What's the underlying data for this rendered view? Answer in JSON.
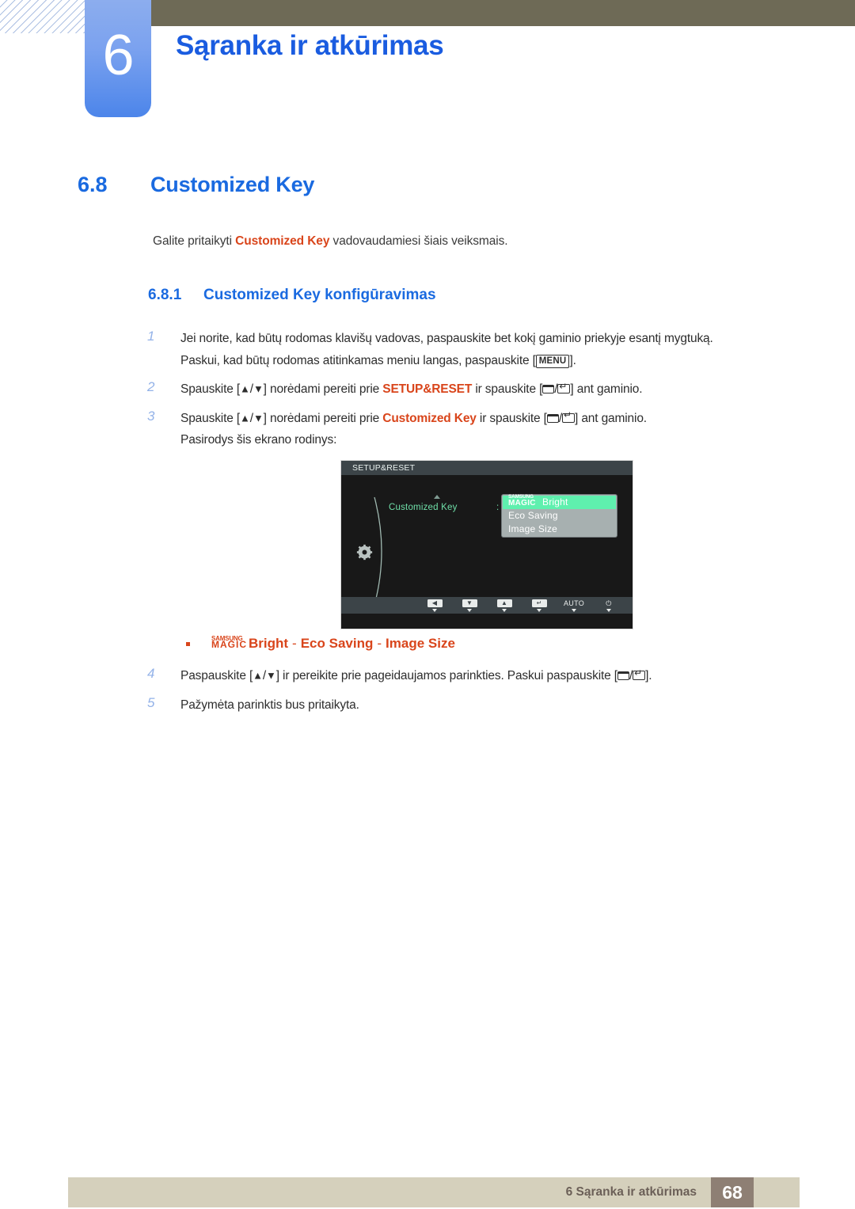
{
  "header": {
    "chapter_number": "6",
    "chapter_title": "Sąranka ir atkūrimas",
    "accent_blue": "#1a5ce0",
    "olive_bar_color": "#6e6a56"
  },
  "section": {
    "number": "6.8",
    "title": "Customized Key",
    "intro_before": "Galite pritaikyti ",
    "intro_keyword": "Customized Key",
    "intro_after": " vadovaudamiesi šiais veiksmais."
  },
  "subsection": {
    "number": "6.8.1",
    "title": "Customized Key konfigūravimas"
  },
  "steps": [
    {
      "number": "1",
      "line1_a": "Jei norite, kad būtų rodomas klavišų vadovas, paspauskite bet kokį gaminio priekyje esantį mygtuką.",
      "line2_a": "Paskui, kad būtų rodomas atitinkamas meniu langas, paspauskite [",
      "key": "MENU",
      "line2_b": "]."
    },
    {
      "number": "2",
      "a": "Spauskite [",
      "b": "] norėdami pereiti prie ",
      "keyword": "SETUP&RESET",
      "c": " ir spauskite [",
      "d": "] ant gaminio."
    },
    {
      "number": "3",
      "a": "Spauskite [",
      "b": "] norėdami pereiti prie ",
      "keyword": "Customized Key",
      "c": " ir spauskite [",
      "d": "] ant gaminio.",
      "extra": "Pasirodys šis ekrano rodinys:"
    },
    {
      "number": "4",
      "a": "Paspauskite [",
      "b": "] ir pereikite prie pageidaujamos parinkties. Paskui paspauskite [",
      "d": "]."
    },
    {
      "number": "5",
      "a": "Pažymėta parinktis bus pritaikyta."
    }
  ],
  "osd": {
    "title": "SETUP&RESET",
    "label": "Customized Key",
    "colon": ":",
    "menu_items": [
      {
        "prefix_small": "SAMSUNG",
        "prefix_large": "MAGIC",
        "text": "Bright",
        "selected": true
      },
      {
        "text": "Eco Saving",
        "selected": false
      },
      {
        "text": "Image Size",
        "selected": false
      }
    ],
    "buttons": [
      {
        "name": "left",
        "glyph": "◀"
      },
      {
        "name": "down",
        "glyph": "▼"
      },
      {
        "name": "up",
        "glyph": "▲"
      },
      {
        "name": "enter",
        "glyph": "↵"
      },
      {
        "name": "auto",
        "glyph": "AUTO",
        "is_text": true
      },
      {
        "name": "power",
        "glyph": "⏻",
        "is_text": true
      }
    ],
    "highlight_color": "#5ff0ae",
    "menu_bg_color": "#a7b0b0",
    "screen_color": "#181818"
  },
  "bullet": {
    "prefix_small": "SAMSUNG",
    "prefix_large": "MAGIC",
    "item1": "Bright",
    "sep": "-",
    "item2": "Eco Saving",
    "item3": "Image Size",
    "color": "#d9451b"
  },
  "footer": {
    "text": "6 Sąranka ir atkūrimas",
    "page": "68",
    "bar_color": "#d5d0bc",
    "page_box_color": "#8e7f74"
  }
}
